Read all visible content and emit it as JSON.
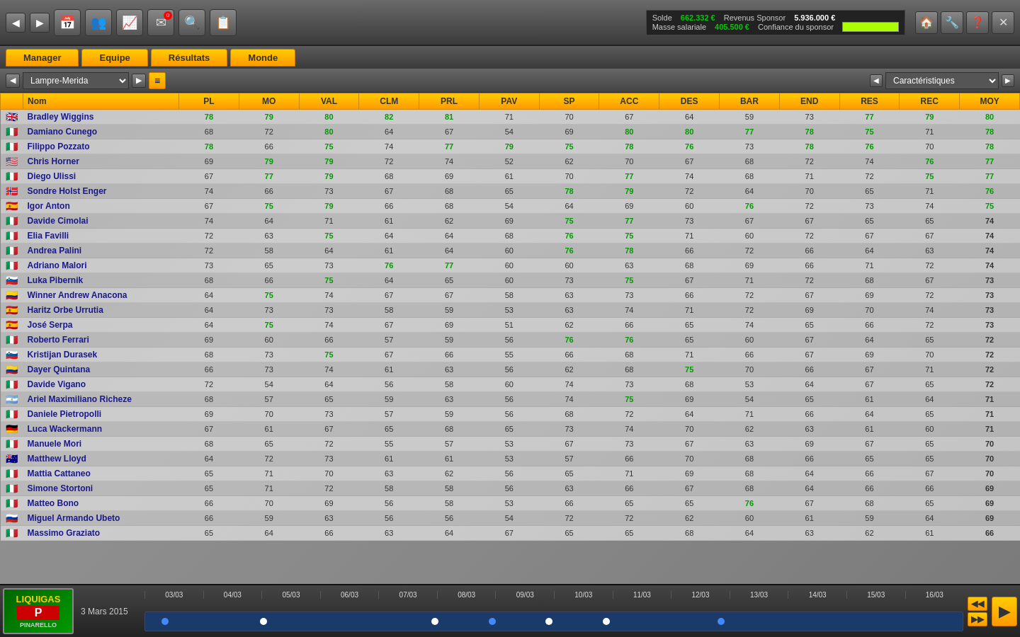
{
  "topbar": {
    "nav_back": "◀",
    "nav_fwd": "▶",
    "finance": {
      "solde_label": "Solde",
      "solde_value": "662.332 €",
      "revenus_label": "Revenus Sponsor",
      "revenus_value": "5.936.000 €",
      "masse_label": "Masse salariale",
      "masse_value": "405.500 €",
      "confiance_label": "Confiance du sponsor"
    },
    "right_icons": [
      "🏠",
      "🔧",
      "❓",
      "✕"
    ]
  },
  "navtabs": [
    "Manager",
    "Equipe",
    "Résultats",
    "Monde"
  ],
  "teambar": {
    "team_name": "Lampre-Merida",
    "view_label": "Caractéristiques"
  },
  "columns": [
    "Nom",
    "PL",
    "MO",
    "VAL",
    "CLM",
    "PRL",
    "PAV",
    "SP",
    "ACC",
    "DES",
    "BAR",
    "END",
    "RES",
    "REC",
    "MOY"
  ],
  "riders": [
    {
      "flag": "🇬🇧",
      "name": "Bradley Wiggins",
      "pl": 78,
      "mo": 79,
      "val": 80,
      "clm": 82,
      "prl": 81,
      "pav": 71,
      "sp": 70,
      "acc": 67,
      "des": 64,
      "bar": 59,
      "end": 73,
      "res": 77,
      "rec": 79,
      "moy": 80,
      "green_cols": [
        2,
        3,
        4
      ]
    },
    {
      "flag": "🇮🇹",
      "name": "Damiano Cunego",
      "pl": 68,
      "mo": 72,
      "val": 80,
      "clm": 64,
      "prl": 67,
      "pav": 54,
      "sp": 69,
      "acc": 80,
      "des": 80,
      "bar": 77,
      "end": 78,
      "res": 75,
      "rec": 71,
      "moy": 78,
      "green_cols": [
        2,
        7,
        8,
        9
      ]
    },
    {
      "flag": "🇮🇹",
      "name": "Filippo Pozzato",
      "pl": 78,
      "mo": 66,
      "val": 75,
      "clm": 74,
      "prl": 77,
      "pav": 79,
      "sp": 75,
      "acc": 78,
      "des": 76,
      "bar": 73,
      "end": 78,
      "res": 76,
      "rec": 70,
      "moy": 78,
      "green_cols": []
    },
    {
      "flag": "🇺🇸",
      "name": "Chris Horner",
      "pl": 69,
      "mo": 79,
      "val": 79,
      "clm": 72,
      "prl": 74,
      "pav": 52,
      "sp": 62,
      "acc": 70,
      "des": 67,
      "bar": 68,
      "end": 72,
      "res": 74,
      "rec": 76,
      "moy": 77,
      "green_cols": [
        1,
        2
      ]
    },
    {
      "flag": "🇮🇹",
      "name": "Diego Ulissi",
      "pl": 67,
      "mo": 77,
      "val": 79,
      "clm": 68,
      "prl": 69,
      "pav": 61,
      "sp": 70,
      "acc": 77,
      "des": 74,
      "bar": 68,
      "end": 71,
      "res": 72,
      "rec": 75,
      "moy": 77,
      "green_cols": [
        1,
        2,
        7
      ]
    },
    {
      "flag": "🇳🇴",
      "name": "Sondre Holst Enger",
      "pl": 74,
      "mo": 66,
      "val": 73,
      "clm": 67,
      "prl": 68,
      "pav": 65,
      "sp": 78,
      "acc": 79,
      "des": 72,
      "bar": 64,
      "end": 70,
      "res": 65,
      "rec": 71,
      "moy": 76,
      "green_cols": [
        6,
        7
      ]
    },
    {
      "flag": "🇪🇸",
      "name": "Igor Anton",
      "pl": 67,
      "mo": 75,
      "val": 79,
      "clm": 66,
      "prl": 68,
      "pav": 54,
      "sp": 64,
      "acc": 69,
      "des": 60,
      "bar": 76,
      "end": 72,
      "res": 73,
      "rec": 74,
      "moy": 75,
      "green_cols": [
        1,
        2
      ]
    },
    {
      "flag": "🇮🇹",
      "name": "Davide Cimolai",
      "pl": 74,
      "mo": 64,
      "val": 71,
      "clm": 61,
      "prl": 62,
      "pav": 69,
      "sp": 75,
      "acc": 77,
      "des": 73,
      "bar": 67,
      "end": 67,
      "res": 65,
      "rec": 65,
      "moy": 74,
      "green_cols": [
        6,
        7
      ]
    },
    {
      "flag": "🇮🇹",
      "name": "Elia Favilli",
      "pl": 72,
      "mo": 63,
      "val": 75,
      "clm": 64,
      "prl": 64,
      "pav": 68,
      "sp": 76,
      "acc": 75,
      "des": 71,
      "bar": 60,
      "end": 72,
      "res": 67,
      "rec": 67,
      "moy": 74,
      "green_cols": [
        2,
        6,
        7
      ]
    },
    {
      "flag": "🇮🇹",
      "name": "Andrea Palini",
      "pl": 72,
      "mo": 58,
      "val": 64,
      "clm": 61,
      "prl": 64,
      "pav": 60,
      "sp": 76,
      "acc": 78,
      "des": 66,
      "bar": 72,
      "end": 66,
      "res": 64,
      "rec": 63,
      "moy": 74,
      "green_cols": [
        6,
        7
      ]
    },
    {
      "flag": "🇮🇹",
      "name": "Adriano Malori",
      "pl": 73,
      "mo": 65,
      "val": 73,
      "clm": 76,
      "prl": 77,
      "pav": 60,
      "sp": 60,
      "acc": 63,
      "des": 68,
      "bar": 69,
      "end": 66,
      "res": 71,
      "rec": 72,
      "moy": 74,
      "green_cols": [
        3,
        4
      ]
    },
    {
      "flag": "🇸🇮",
      "name": "Luka Pibernik",
      "pl": 68,
      "mo": 66,
      "val": 75,
      "clm": 64,
      "prl": 65,
      "pav": 60,
      "sp": 73,
      "acc": 75,
      "des": 67,
      "bar": 71,
      "end": 72,
      "res": 68,
      "rec": 67,
      "moy": 73,
      "green_cols": [
        2,
        6,
        7
      ]
    },
    {
      "flag": "🇨🇴",
      "name": "Winner Andrew Anacona",
      "pl": 64,
      "mo": 75,
      "val": 74,
      "clm": 67,
      "prl": 67,
      "pav": 58,
      "sp": 63,
      "acc": 73,
      "des": 66,
      "bar": 72,
      "end": 67,
      "res": 69,
      "rec": 72,
      "moy": 73,
      "green_cols": [
        1
      ]
    },
    {
      "flag": "🇪🇸",
      "name": "Haritz Orbe Urrutia",
      "pl": 64,
      "mo": 73,
      "val": 73,
      "clm": 58,
      "prl": 59,
      "pav": 53,
      "sp": 63,
      "acc": 74,
      "des": 71,
      "bar": 72,
      "end": 69,
      "res": 70,
      "rec": 74,
      "moy": 73,
      "green_cols": []
    },
    {
      "flag": "🇪🇸",
      "name": "José Serpa",
      "pl": 64,
      "mo": 75,
      "val": 74,
      "clm": 67,
      "prl": 69,
      "pav": 51,
      "sp": 62,
      "acc": 66,
      "des": 65,
      "bar": 74,
      "end": 65,
      "res": 66,
      "rec": 72,
      "moy": 73,
      "green_cols": [
        1
      ]
    },
    {
      "flag": "🇮🇹",
      "name": "Roberto Ferrari",
      "pl": 69,
      "mo": 60,
      "val": 66,
      "clm": 57,
      "prl": 59,
      "pav": 56,
      "sp": 76,
      "acc": 76,
      "des": 65,
      "bar": 60,
      "end": 67,
      "res": 64,
      "rec": 65,
      "moy": 72,
      "green_cols": [
        6,
        7
      ]
    },
    {
      "flag": "🇸🇮",
      "name": "Kristijan Durasek",
      "pl": 68,
      "mo": 73,
      "val": 75,
      "clm": 67,
      "prl": 66,
      "pav": 55,
      "sp": 66,
      "acc": 68,
      "des": 71,
      "bar": 66,
      "end": 67,
      "res": 69,
      "rec": 70,
      "moy": 72,
      "green_cols": [
        2
      ]
    },
    {
      "flag": "🇨🇴",
      "name": "Dayer Quintana",
      "pl": 66,
      "mo": 73,
      "val": 74,
      "clm": 61,
      "prl": 63,
      "pav": 56,
      "sp": 62,
      "acc": 68,
      "des": 75,
      "bar": 70,
      "end": 66,
      "res": 67,
      "rec": 71,
      "moy": 72,
      "green_cols": [
        8
      ]
    },
    {
      "flag": "🇮🇹",
      "name": "Davide Vigano",
      "pl": 72,
      "mo": 54,
      "val": 64,
      "clm": 56,
      "prl": 58,
      "pav": 60,
      "sp": 74,
      "acc": 73,
      "des": 68,
      "bar": 53,
      "end": 64,
      "res": 67,
      "rec": 65,
      "moy": 72,
      "green_cols": []
    },
    {
      "flag": "🇦🇷",
      "name": "Ariel Maximiliano Richeze",
      "pl": 68,
      "mo": 57,
      "val": 65,
      "clm": 59,
      "prl": 63,
      "pav": 56,
      "sp": 74,
      "acc": 75,
      "des": 69,
      "bar": 54,
      "end": 65,
      "res": 61,
      "rec": 64,
      "moy": 71,
      "green_cols": [
        6,
        7
      ]
    },
    {
      "flag": "🇮🇹",
      "name": "Daniele Pietropolli",
      "pl": 69,
      "mo": 70,
      "val": 73,
      "clm": 57,
      "prl": 59,
      "pav": 56,
      "sp": 68,
      "acc": 72,
      "des": 64,
      "bar": 71,
      "end": 66,
      "res": 64,
      "rec": 65,
      "moy": 71,
      "green_cols": []
    },
    {
      "flag": "🇩🇪",
      "name": "Luca Wackermann",
      "pl": 67,
      "mo": 61,
      "val": 67,
      "clm": 65,
      "prl": 68,
      "pav": 65,
      "sp": 73,
      "acc": 74,
      "des": 70,
      "bar": 62,
      "end": 63,
      "res": 61,
      "rec": 60,
      "moy": 71,
      "green_cols": []
    },
    {
      "flag": "🇮🇹",
      "name": "Manuele Mori",
      "pl": 68,
      "mo": 65,
      "val": 72,
      "clm": 55,
      "prl": 57,
      "pav": 53,
      "sp": 67,
      "acc": 73,
      "des": 67,
      "bar": 63,
      "end": 69,
      "res": 67,
      "rec": 65,
      "moy": 70,
      "green_cols": []
    },
    {
      "flag": "🇦🇺",
      "name": "Matthew Lloyd",
      "pl": 64,
      "mo": 72,
      "val": 73,
      "clm": 61,
      "prl": 61,
      "pav": 53,
      "sp": 57,
      "acc": 66,
      "des": 70,
      "bar": 68,
      "end": 66,
      "res": 65,
      "rec": 65,
      "moy": 70,
      "green_cols": []
    },
    {
      "flag": "🇮🇹",
      "name": "Mattia Cattaneo",
      "pl": 65,
      "mo": 71,
      "val": 70,
      "clm": 63,
      "prl": 62,
      "pav": 56,
      "sp": 65,
      "acc": 71,
      "des": 69,
      "bar": 68,
      "end": 64,
      "res": 66,
      "rec": 67,
      "moy": 70,
      "green_cols": []
    },
    {
      "flag": "🇮🇹",
      "name": "Simone Stortoni",
      "pl": 65,
      "mo": 71,
      "val": 72,
      "clm": 58,
      "prl": 58,
      "pav": 56,
      "sp": 63,
      "acc": 66,
      "des": 67,
      "bar": 68,
      "end": 64,
      "res": 66,
      "rec": 66,
      "moy": 69,
      "green_cols": []
    },
    {
      "flag": "🇮🇹",
      "name": "Matteo Bono",
      "pl": 66,
      "mo": 70,
      "val": 69,
      "clm": 56,
      "prl": 58,
      "pav": 53,
      "sp": 66,
      "acc": 65,
      "des": 65,
      "bar": 76,
      "end": 67,
      "res": 68,
      "rec": 65,
      "moy": 69,
      "green_cols": [
        9
      ]
    },
    {
      "flag": "🇷🇺",
      "name": "Miguel Armando Ubeto",
      "pl": 66,
      "mo": 59,
      "val": 63,
      "clm": 56,
      "prl": 56,
      "pav": 54,
      "sp": 72,
      "acc": 72,
      "des": 62,
      "bar": 60,
      "end": 61,
      "res": 59,
      "rec": 64,
      "moy": 69,
      "green_cols": []
    },
    {
      "flag": "🇮🇹",
      "name": "Massimo Graziato",
      "pl": 65,
      "mo": 64,
      "val": 66,
      "clm": 63,
      "prl": 64,
      "pav": 67,
      "sp": 65,
      "acc": 65,
      "des": 68,
      "bar": 64,
      "end": 63,
      "res": 62,
      "rec": 61,
      "moy": 66,
      "green_cols": []
    }
  ],
  "timeline": {
    "dates": [
      "03/03",
      "04/03",
      "05/03",
      "06/03",
      "07/03",
      "08/03",
      "09/03",
      "10/03",
      "11/03",
      "12/03",
      "13/03",
      "14/03",
      "15/03",
      "16/03"
    ],
    "current_date": "3 Mars 2015"
  },
  "sponsor": {
    "name": "LIQUIGAS",
    "sub": "PINARELLO"
  }
}
